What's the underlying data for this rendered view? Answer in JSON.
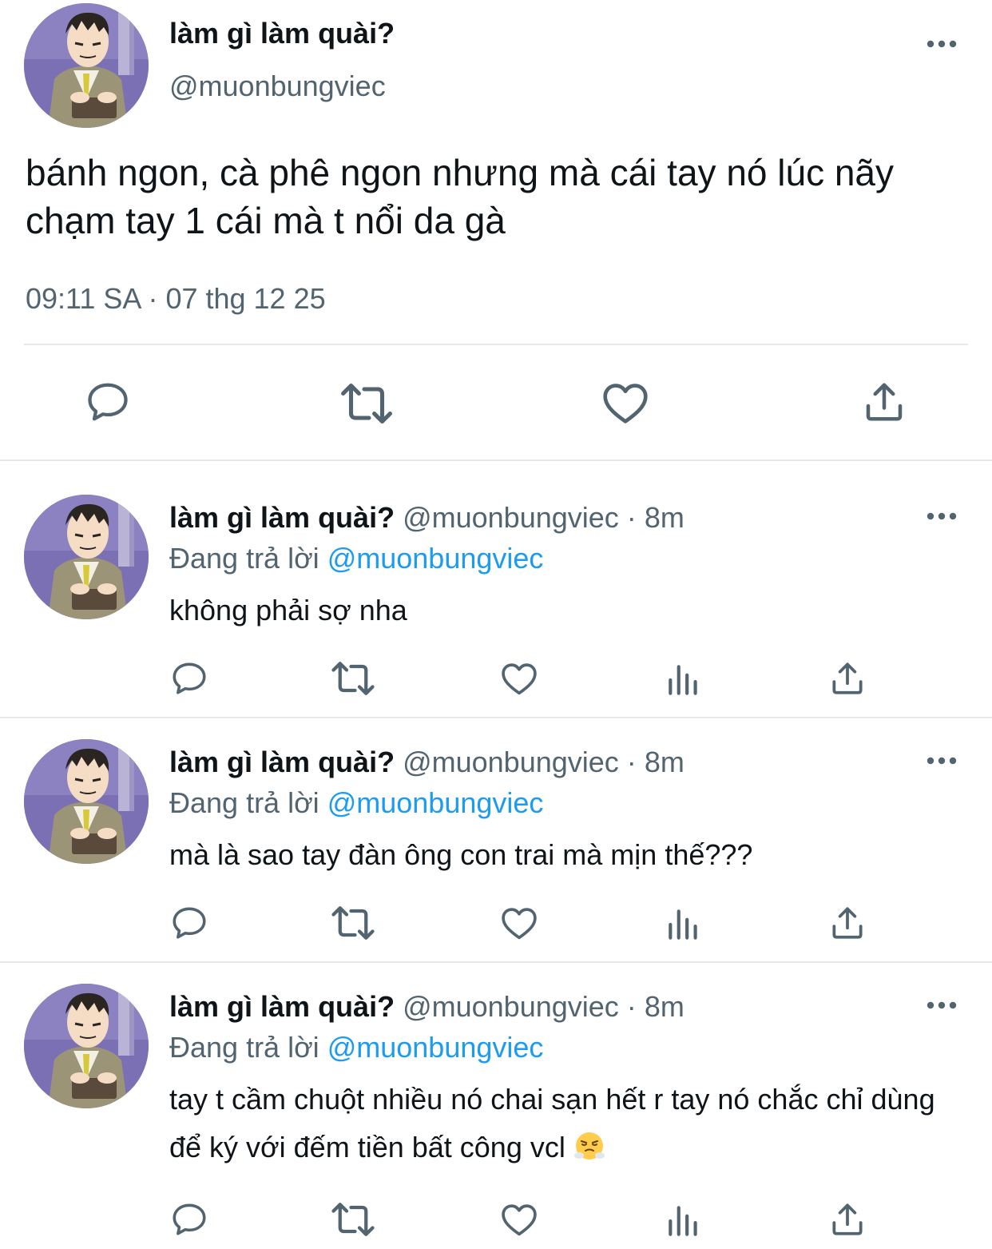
{
  "main_tweet": {
    "display_name": "làm gì làm quài?",
    "handle": "@muonbungviec",
    "text": "bánh ngon, cà phê ngon nhưng mà cái tay nó lúc nãy chạm tay 1 cái mà t nổi da gà",
    "meta": "09:11 SA · 07 thg 12 25",
    "actions": [
      "reply-icon",
      "retweet-icon",
      "like-icon",
      "share-icon"
    ]
  },
  "replies": [
    {
      "display_name": "làm gì làm quài?",
      "handle": "@muonbungviec",
      "separator": "·",
      "time": "8m",
      "replying_label": "Đang trả lời",
      "replying_to": "@muonbungviec",
      "text": "không phải sợ nha"
    },
    {
      "display_name": "làm gì làm quài?",
      "handle": "@muonbungviec",
      "separator": "·",
      "time": "8m",
      "replying_label": "Đang trả lời",
      "replying_to": "@muonbungviec",
      "text": "mà là sao tay đàn ông con trai mà mịn thế???"
    },
    {
      "display_name": "làm gì làm quài?",
      "handle": "@muonbungviec",
      "separator": "·",
      "time": "8m",
      "replying_label": "Đang trả lời",
      "replying_to": "@muonbungviec",
      "text": "tay t cầm chuột nhiều nó chai sạn hết r tay nó chắc chỉ dùng để ký với đếm tiền bất công vcl",
      "trailing_icon": "steaming-face-emoji"
    }
  ],
  "colors": {
    "text": "#0f1419",
    "muted": "#536471",
    "link": "#1d9bf0",
    "divider": "#e6e9ec"
  }
}
